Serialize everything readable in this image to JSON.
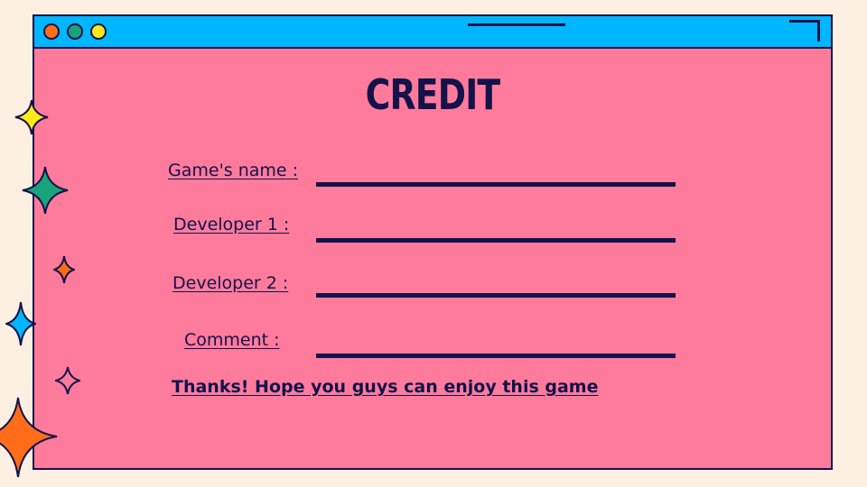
{
  "window": {
    "controls": [
      {
        "name": "close",
        "color": "#ff6d1b"
      },
      {
        "name": "minimize",
        "color": "#1aa37a"
      },
      {
        "name": "maximize",
        "color": "#ffe81a"
      }
    ]
  },
  "title": "CREDIT",
  "form": {
    "fields": [
      {
        "label": "Game's name :",
        "value": ""
      },
      {
        "label": "Developer 1 :",
        "value": ""
      },
      {
        "label": "Developer 2 :",
        "value": ""
      },
      {
        "label": "Comment :",
        "value": ""
      }
    ]
  },
  "message": "Thanks! Hope you guys can enjoy this game",
  "colors": {
    "background": "#fdf0e3",
    "window": "#ff7b9c",
    "titlebar": "#00b6ff",
    "ink": "#13124a"
  },
  "decorations": [
    {
      "icon": "sparkle-icon",
      "color": "#ffe81a"
    },
    {
      "icon": "sparkle-icon",
      "color": "#1aa37a"
    },
    {
      "icon": "sparkle-icon",
      "color": "#ff6d1b"
    },
    {
      "icon": "sparkle-icon",
      "color": "#00b6ff"
    },
    {
      "icon": "sparkle-outline-icon",
      "color": "#13124a"
    },
    {
      "icon": "sparkle-icon",
      "color": "#ff6d1b"
    }
  ]
}
